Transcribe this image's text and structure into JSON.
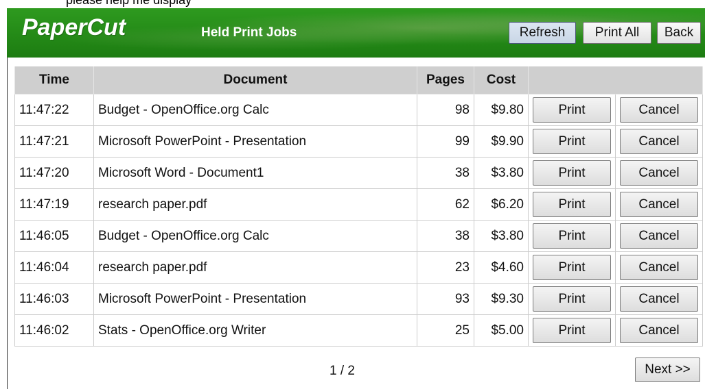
{
  "top_strip": {
    "text": "please help me display"
  },
  "header": {
    "logo": "PaperCut",
    "title": "Held Print Jobs",
    "buttons": {
      "refresh": "Refresh",
      "print_all": "Print All",
      "back": "Back"
    }
  },
  "table": {
    "columns": {
      "time": "Time",
      "document": "Document",
      "pages": "Pages",
      "cost": "Cost"
    },
    "rows": [
      {
        "time": "11:47:22",
        "document": "Budget - OpenOffice.org Calc",
        "pages": "98",
        "cost": "$9.80",
        "print": "Print",
        "cancel": "Cancel"
      },
      {
        "time": "11:47:21",
        "document": "Microsoft PowerPoint - Presentation",
        "pages": "99",
        "cost": "$9.90",
        "print": "Print",
        "cancel": "Cancel"
      },
      {
        "time": "11:47:20",
        "document": "Microsoft Word - Document1",
        "pages": "38",
        "cost": "$3.80",
        "print": "Print",
        "cancel": "Cancel"
      },
      {
        "time": "11:47:19",
        "document": "research paper.pdf",
        "pages": "62",
        "cost": "$6.20",
        "print": "Print",
        "cancel": "Cancel"
      },
      {
        "time": "11:46:05",
        "document": "Budget - OpenOffice.org Calc",
        "pages": "38",
        "cost": "$3.80",
        "print": "Print",
        "cancel": "Cancel"
      },
      {
        "time": "11:46:04",
        "document": "research paper.pdf",
        "pages": "23",
        "cost": "$4.60",
        "print": "Print",
        "cancel": "Cancel"
      },
      {
        "time": "11:46:03",
        "document": "Microsoft PowerPoint - Presentation",
        "pages": "93",
        "cost": "$9.30",
        "print": "Print",
        "cancel": "Cancel"
      },
      {
        "time": "11:46:02",
        "document": "Stats - OpenOffice.org Writer",
        "pages": "25",
        "cost": "$5.00",
        "print": "Print",
        "cancel": "Cancel"
      }
    ]
  },
  "pagination": {
    "page_indicator": "1 / 2",
    "next_label": "Next >>"
  },
  "colors": {
    "header_green": "#248a17",
    "button_face": "#e2e2e2",
    "header_row": "#cfcfcf"
  }
}
